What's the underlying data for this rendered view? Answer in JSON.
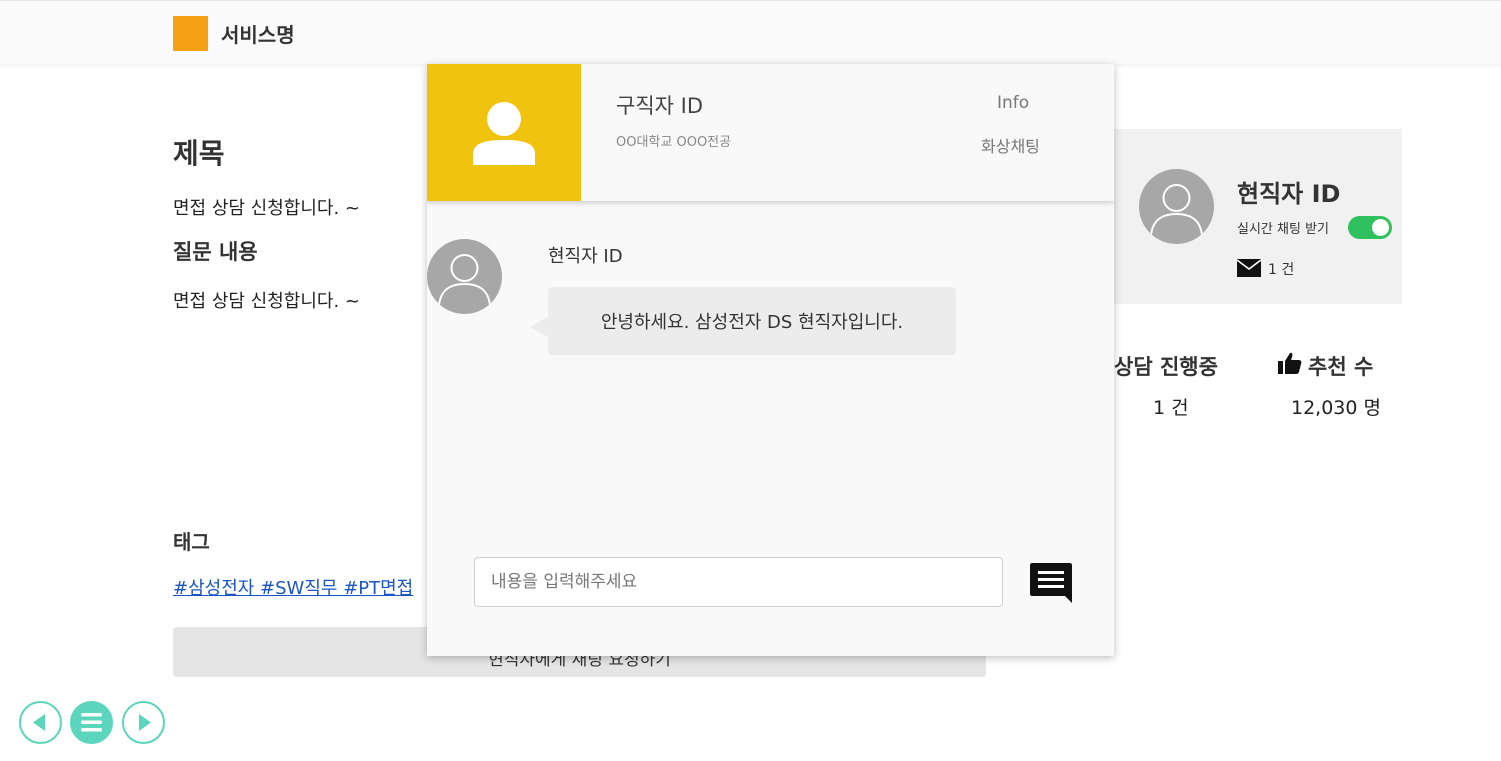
{
  "header": {
    "service_name": "서비스명"
  },
  "post": {
    "title": "제목",
    "body": "면접 상담 신청합니다. ~",
    "question_heading": "질문 내용",
    "question_body": "면접 상담 신청합니다. ~",
    "tag_heading": "태그",
    "tags": "#삼성전자 #SW직무 #PT면접",
    "action_button": "현직자에게 채팅 요청하기"
  },
  "profile": {
    "id": "현직자 ID",
    "realtime_label": "실시간 채팅 받기",
    "realtime_enabled": true,
    "mail_count": "1 건"
  },
  "stats": {
    "consult_label": "상담 진행중",
    "consult_value": "1 건",
    "recommend_label": "추천 수",
    "recommend_value": "12,030 명"
  },
  "chat": {
    "seeker_id": "구직자 ID",
    "seeker_school": "OO대학교 OOO전공",
    "info_link": "Info",
    "video_link": "화상채팅",
    "message_sender": "현직자 ID",
    "message_text": "안녕하세요. 삼성전자 DS 현직자입니다.",
    "input_placeholder": "내용을 입력해주세요"
  },
  "colors": {
    "logo": "#f5a015",
    "chat_header_avatar_bg": "#f0c30f",
    "toggle_on": "#2fc15d",
    "nav_accent": "#5cd5bd",
    "tag_link": "#1a55c8"
  },
  "icons": [
    "user-silhouette-icon",
    "mail-icon",
    "thumbs-up-icon",
    "send-chat-icon",
    "prev-arrow-icon",
    "menu-icon",
    "next-arrow-icon"
  ]
}
